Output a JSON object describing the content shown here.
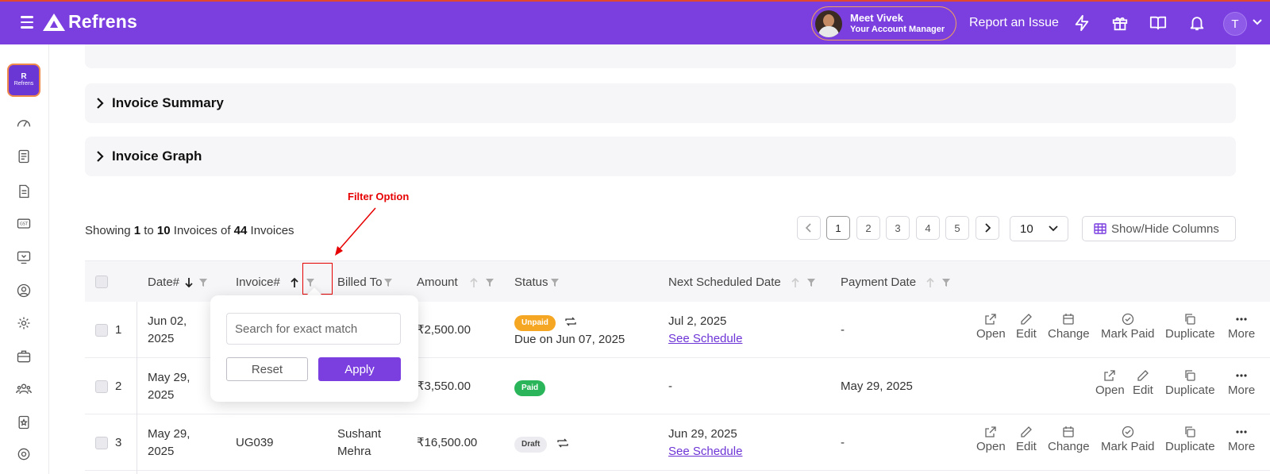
{
  "brand": {
    "name": "Refrens",
    "sidebar_logo_text": "Refrens"
  },
  "header": {
    "manager_name": "Meet Vivek",
    "manager_role": "Your Account Manager",
    "report_issue": "Report an Issue",
    "user_initial": "T"
  },
  "sections": {
    "invoice_summary": "Invoice Summary",
    "invoice_graph": "Invoice Graph"
  },
  "annotation": {
    "label": "Filter Option"
  },
  "listing": {
    "showing_prefix": "Showing",
    "from": "1",
    "to_word": "to",
    "to": "10",
    "entity": "Invoices",
    "of_word": "of",
    "total": "44",
    "entity_total": "Invoices"
  },
  "pagination": {
    "pages": [
      "1",
      "2",
      "3",
      "4",
      "5"
    ],
    "current": "1",
    "per_page": "10"
  },
  "show_hide_columns": "Show/Hide Columns",
  "columns": {
    "date": "Date#",
    "invoice": "Invoice#",
    "billed_to": "Billed To",
    "amount": "Amount",
    "status": "Status",
    "next_scheduled": "Next Scheduled Date",
    "payment_date": "Payment Date"
  },
  "filter_popup": {
    "placeholder": "Search for exact match",
    "reset": "Reset",
    "apply": "Apply"
  },
  "rows": [
    {
      "index": "1",
      "date_line1": "Jun 02,",
      "date_line2": "2025",
      "amount": "₹2,500.00",
      "status": "Unpaid",
      "status_due": "Due on Jun 07, 2025",
      "next_date": "Jul 2, 2025",
      "see_schedule": "See Schedule",
      "payment_date": "-",
      "actions": [
        "Open",
        "Edit",
        "Change",
        "Mark Paid",
        "Duplicate",
        "More"
      ]
    },
    {
      "index": "2",
      "date_line1": "May 29,",
      "date_line2": "2025",
      "amount": "₹3,550.00",
      "status": "Paid",
      "next_date": "-",
      "payment_date": "May 29, 2025",
      "actions": [
        "Open",
        "Edit",
        "Duplicate",
        "More"
      ]
    },
    {
      "index": "3",
      "date_line1": "May 29,",
      "date_line2": "2025",
      "invoice": "UG039",
      "billed_line1": "Sushant",
      "billed_line2": "Mehra",
      "amount": "₹16,500.00",
      "status": "Draft",
      "next_date": "Jun 29, 2025",
      "see_schedule": "See Schedule",
      "payment_date": "-",
      "actions": [
        "Open",
        "Edit",
        "Change",
        "Mark Paid",
        "Duplicate",
        "More"
      ]
    }
  ],
  "colors": {
    "brand_purple": "#7b3fe0",
    "annotation_red": "#e60000",
    "unpaid": "#f5a623",
    "paid": "#2bb55a"
  }
}
